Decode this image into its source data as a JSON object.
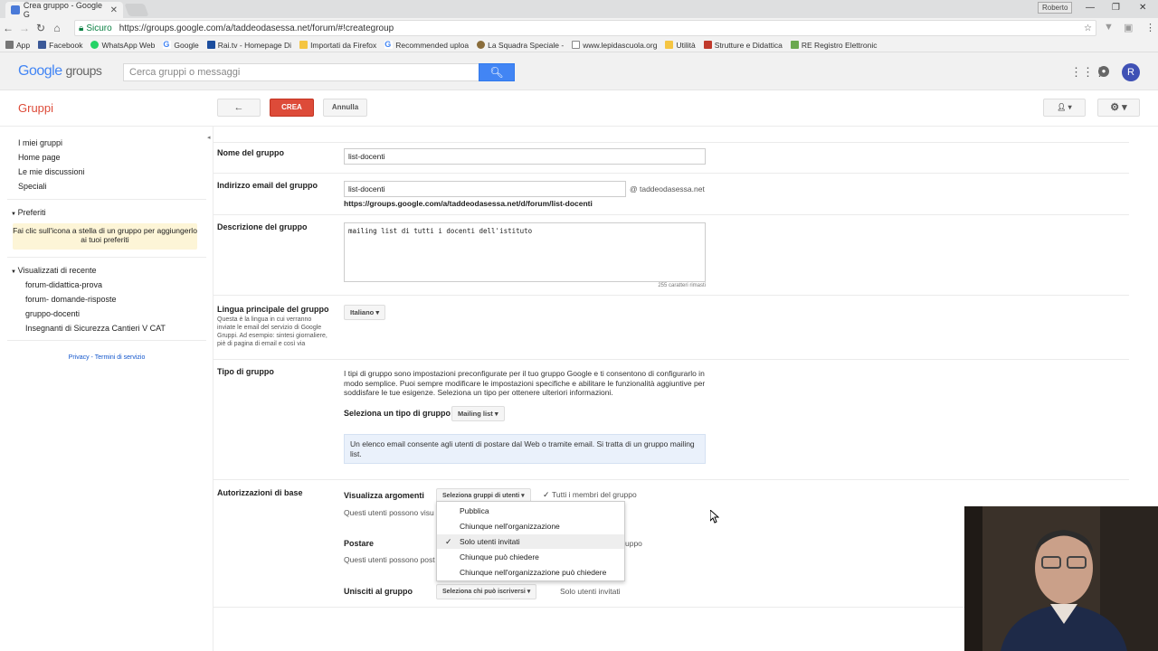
{
  "browser": {
    "tab_title": "Crea gruppo - Google G",
    "profile": "Roberto",
    "secure_label": "Sicuro",
    "url": "https://groups.google.com/a/taddeodasessa.net/forum/#!creategroup",
    "bookmarks": [
      "App",
      "Facebook",
      "WhatsApp Web",
      "Google",
      "Rai.tv - Homepage Di",
      "Importati da Firefox",
      "Recommended uploa",
      "La Squadra Speciale -",
      "www.lepidascuola.org",
      "Utilità",
      "Strutture e Didattica",
      "RE Registro Elettronic"
    ]
  },
  "header": {
    "logo_google": "Google",
    "logo_groups": "groups",
    "search_placeholder": "Cerca gruppi o messaggi",
    "avatar_letter": "R"
  },
  "toolbar": {
    "section_title": "Gruppi",
    "back_symbol": "←",
    "create_label": "CREA",
    "cancel_label": "Annulla"
  },
  "sidebar": {
    "nav": [
      "I miei gruppi",
      "Home page",
      "Le mie discussioni",
      "Speciali"
    ],
    "favorites_title": "Preferiti",
    "favorites_hint": "Fai clic sull'icona a stella di un gruppo per aggiungerlo ai tuoi preferiti",
    "recent_title": "Visualizzati di recente",
    "recent": [
      "forum-didattica-prova",
      "forum- domande-risposte",
      "gruppo-docenti",
      "Insegnanti di Sicurezza Cantieri V CAT"
    ],
    "privacy": "Privacy",
    "terms": "Termini di servizio",
    "privacy_sep": " - "
  },
  "form": {
    "name_label": "Nome del gruppo",
    "name_value": "list-docenti",
    "email_label": "Indirizzo email del gruppo",
    "email_value": "list-docenti",
    "email_domain": "@ taddeodasessa.net",
    "group_url": "https://groups.google.com/a/taddeodasessa.net/d/forum/list-docenti",
    "desc_label": "Descrizione del gruppo",
    "desc_value": "mailing list di tutti i docenti dell'istituto",
    "chars_left": "255 caratteri rimasti",
    "lang_label": "Lingua principale del gruppo",
    "lang_help": "Questa è la lingua in cui verranno inviate le email del servizio di Google Gruppi. Ad esempio: sintesi giornaliere, piè di pagina di email e così via",
    "lang_value": "Italiano",
    "type_label": "Tipo di gruppo",
    "type_intro": "I tipi di gruppo sono impostazioni preconfigurate per il tuo gruppo Google e ti consentono di configurarlo in modo semplice. Puoi sempre modificare le impostazioni specifiche e abilitare le funzionalità aggiuntive per soddisfare le tue esigenze. Seleziona un tipo per ottenere ulteriori informazioni.",
    "type_select_label": "Seleziona un tipo di gruppo",
    "type_value": "Mailing list",
    "type_info": "Un elenco email consente agli utenti di postare dal Web o tramite email. Si tratta di un gruppo mailing list.",
    "perm_label": "Autorizzazioni di base",
    "view_label": "Visualizza argomenti",
    "view_btn": "Seleziona gruppi di utenti",
    "view_value": "Tutti i membri del gruppo",
    "view_note": "Questi utenti possono visu",
    "post_label": "Postare",
    "post_value": "uppo",
    "post_note": "Questi utenti possono post",
    "join_label": "Unisciti al gruppo",
    "join_btn": "Seleziona chi può iscriversi",
    "join_value": "Solo utenti invitati"
  },
  "dropdown": {
    "items": [
      "Pubblica",
      "Chiunque nell'organizzazione",
      "Solo utenti invitati",
      "Chiunque può chiedere",
      "Chiunque nell'organizzazione può chiedere"
    ],
    "selected_index": 2
  },
  "colors": {
    "create_button": "#dd4b39",
    "search_button": "#4285f4",
    "favorites_hint_bg": "#fdf5d7",
    "info_box_bg": "#eaf1fb"
  }
}
